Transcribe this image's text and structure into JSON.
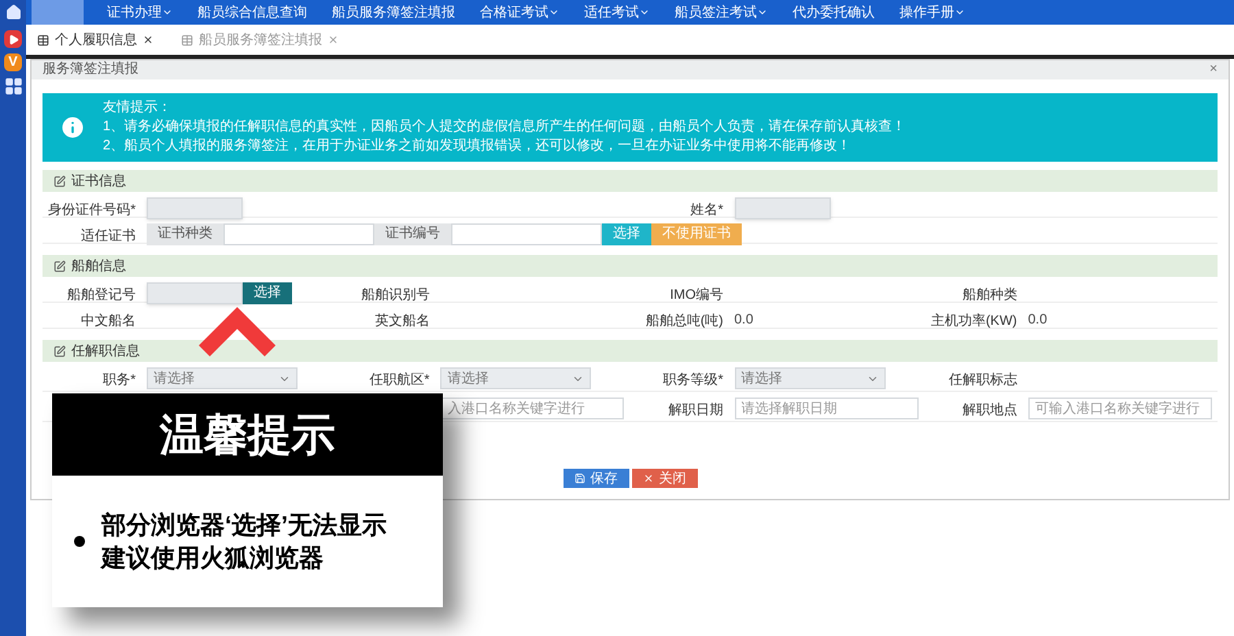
{
  "nav": {
    "items": [
      {
        "label": "证书办理",
        "dropdown": true
      },
      {
        "label": "船员综合信息查询",
        "dropdown": false
      },
      {
        "label": "船员服务簿签注填报",
        "dropdown": false
      },
      {
        "label": "合格证考试",
        "dropdown": true
      },
      {
        "label": "适任考试",
        "dropdown": true
      },
      {
        "label": "船员签注考试",
        "dropdown": true
      },
      {
        "label": "代办委托确认",
        "dropdown": false
      },
      {
        "label": "操作手册",
        "dropdown": true
      }
    ]
  },
  "sidebar": {
    "icons": [
      {
        "kind": "video"
      },
      {
        "kind": "letter",
        "text": "V"
      },
      {
        "kind": "grid"
      }
    ]
  },
  "tabs": [
    {
      "label": "个人履职信息",
      "selected": true
    },
    {
      "label": "船员服务簿签注填报",
      "selected": false
    }
  ],
  "panel": {
    "title": "服务簿签注填报",
    "close": "×"
  },
  "notice": {
    "title": "友情提示：",
    "lines": [
      "1、请务必确保填报的任解职信息的真实性，因船员个人提交的虚假信息所产生的任何问题，由船员个人负责，请在保存前认真核查！",
      "2、船员个人填报的服务簿签注，在用于办证业务之前如发现填报错误，还可以修改，一旦在办证业务中使用将不能再修改！"
    ]
  },
  "sections": [
    {
      "title": "证书信息",
      "rows": [
        {
          "kind": "grid",
          "cells": [
            {
              "kind": "field",
              "label": "身份证件号码*",
              "controls": [
                {
                  "kind": "input",
                  "readonly": true
                }
              ]
            },
            {
              "kind": "field",
              "label": "姓名*",
              "controls": [
                {
                  "kind": "input",
                  "readonly": true
                }
              ]
            }
          ]
        },
        {
          "kind": "wide",
          "cells": [
            {
              "kind": "field",
              "label": "适任证书",
              "controls": [
                {
                  "kind": "addon",
                  "label": "证书种类"
                },
                {
                  "kind": "input",
                  "readonly": false
                },
                {
                  "kind": "addon",
                  "label": "证书编号"
                },
                {
                  "kind": "input",
                  "readonly": false
                },
                {
                  "kind": "button",
                  "label": "选择",
                  "color": "#1fb5c9"
                },
                {
                  "kind": "button",
                  "label": "不使用证书",
                  "color": "#f0ad4e"
                }
              ]
            }
          ]
        }
      ]
    },
    {
      "title": "船舶信息",
      "rows": [
        {
          "kind": "grid",
          "cells": [
            {
              "kind": "field",
              "label": "船舶登记号",
              "controls": [
                {
                  "kind": "input",
                  "readonly": true
                },
                {
                  "kind": "button",
                  "label": "选择",
                  "color": "#17707a"
                }
              ]
            },
            {
              "kind": "field",
              "label": "船舶识别号"
            },
            {
              "kind": "field",
              "label": "IMO编号"
            },
            {
              "kind": "field",
              "label": "船舶种类"
            }
          ]
        },
        {
          "kind": "grid",
          "cells": [
            {
              "kind": "field",
              "label": "中文船名"
            },
            {
              "kind": "field",
              "label": "英文船名"
            },
            {
              "kind": "field",
              "label": "船舶总吨(吨)",
              "controls": [
                {
                  "kind": "text",
                  "value": "0.0"
                }
              ]
            },
            {
              "kind": "field",
              "label": "主机功率(KW)",
              "controls": [
                {
                  "kind": "text",
                  "value": "0.0"
                }
              ]
            }
          ]
        }
      ]
    },
    {
      "title": "任解职信息",
      "rows": [
        {
          "kind": "grid",
          "cells": [
            {
              "kind": "field",
              "label": "职务*",
              "controls": [
                {
                  "kind": "select",
                  "placeholder": "请选择"
                }
              ]
            },
            {
              "kind": "field",
              "label": "任职航区*",
              "controls": [
                {
                  "kind": "select",
                  "placeholder": "请选择"
                }
              ]
            },
            {
              "kind": "field",
              "label": "职务等级*",
              "controls": [
                {
                  "kind": "select",
                  "placeholder": "请选择"
                }
              ]
            },
            {
              "kind": "field",
              "label": "任解职标志"
            }
          ]
        },
        {
          "kind": "grid",
          "cells": [
            {
              "kind": "blank"
            },
            {
              "kind": "field",
              "controls": [
                {
                  "kind": "input",
                  "readonly": false,
                  "placeholder": "入港口名称关键字进行"
                }
              ]
            },
            {
              "kind": "field",
              "label": "解职日期",
              "controls": [
                {
                  "kind": "input",
                  "readonly": false,
                  "placeholder": "请选择解职日期"
                }
              ]
            },
            {
              "kind": "field",
              "label": "解职地点",
              "controls": [
                {
                  "kind": "input",
                  "readonly": false,
                  "placeholder": "可输入港口名称关键字进行"
                }
              ]
            }
          ]
        }
      ]
    }
  ],
  "actions": [
    {
      "kind": "save",
      "label": "保存",
      "color": "#3a7fd5"
    },
    {
      "kind": "close",
      "label": "关闭",
      "color": "#e0604a"
    }
  ],
  "tip": {
    "title": "温馨提示",
    "lines": [
      "部分浏览器‘选择’无法显示",
      "建议使用火狐浏览器"
    ]
  }
}
